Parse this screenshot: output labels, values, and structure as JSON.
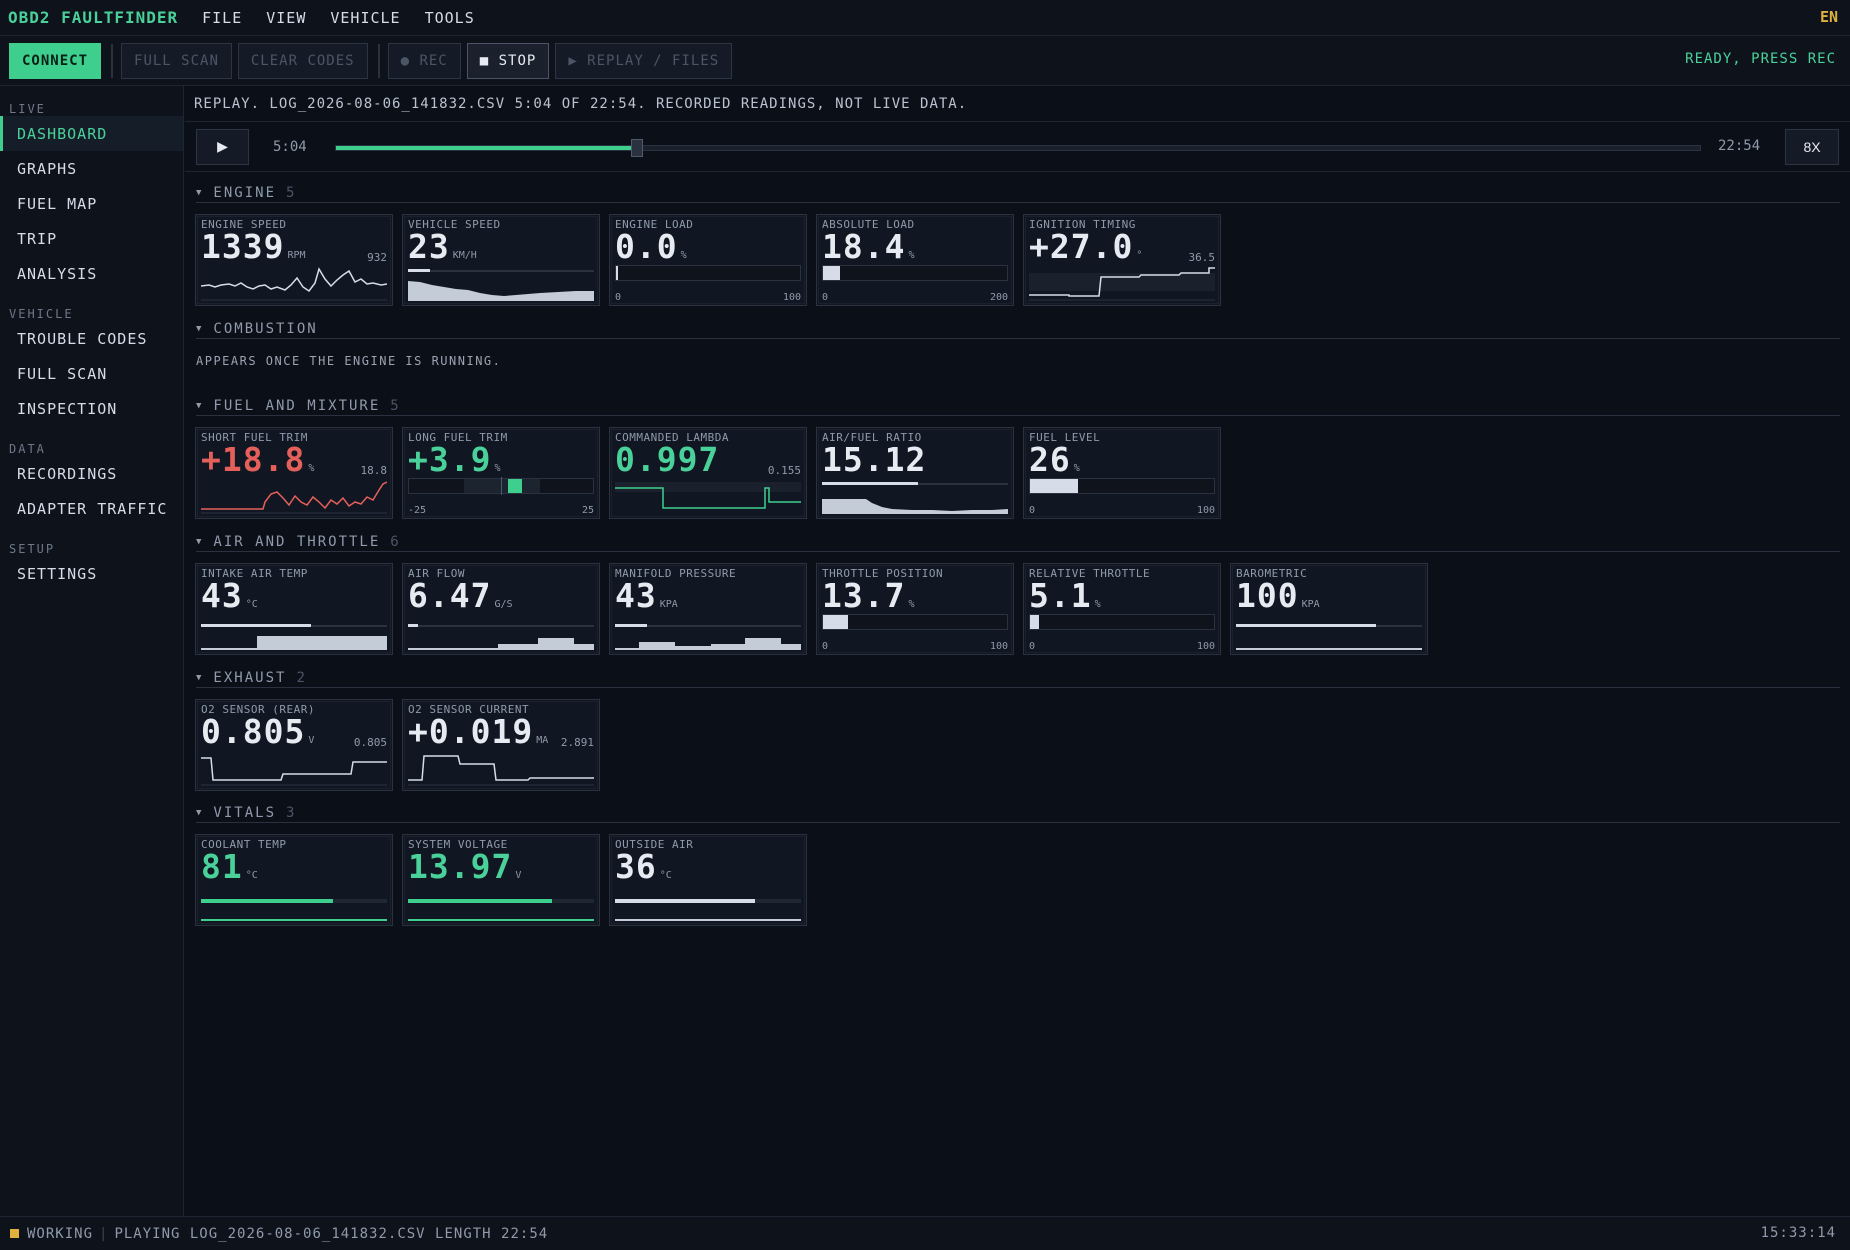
{
  "app": {
    "title": "OBD2 FAULTFINDER",
    "lang": "EN"
  },
  "menu": [
    "FILE",
    "VIEW",
    "VEHICLE",
    "TOOLS"
  ],
  "toolbar": {
    "connect": "CONNECT",
    "full_scan": "FULL SCAN",
    "clear_codes": "CLEAR CODES",
    "rec": "● REC",
    "stop": "■ STOP",
    "replay": "▶ REPLAY / FILES",
    "status": "READY, PRESS REC"
  },
  "sidebar": {
    "groups": [
      {
        "heading": "LIVE",
        "items": [
          "DASHBOARD",
          "GRAPHS",
          "FUEL MAP",
          "TRIP",
          "ANALYSIS"
        ]
      },
      {
        "heading": "VEHICLE",
        "items": [
          "TROUBLE CODES",
          "FULL SCAN",
          "INSPECTION"
        ]
      },
      {
        "heading": "DATA",
        "items": [
          "RECORDINGS",
          "ADAPTER TRAFFIC"
        ]
      },
      {
        "heading": "SETUP",
        "items": [
          "SETTINGS"
        ]
      }
    ],
    "active": "DASHBOARD"
  },
  "replay": {
    "banner": "REPLAY. LOG_2026-08-06_141832.CSV 5:04 OF 22:54. RECORDED READINGS, NOT LIVE DATA.",
    "play_icon": "▶",
    "position": "5:04",
    "length": "22:54",
    "progress_fraction": 0.221,
    "speed": "8X"
  },
  "sections": {
    "engine": {
      "title": "ENGINE",
      "count": "5"
    },
    "combustion": {
      "title": "COMBUSTION",
      "note": "APPEARS ONCE THE ENGINE IS RUNNING."
    },
    "fuel": {
      "title": "FUEL AND MIXTURE",
      "count": "5"
    },
    "air": {
      "title": "AIR AND THROTTLE",
      "count": "6"
    },
    "exhaust": {
      "title": "EXHAUST",
      "count": "2"
    },
    "vitals": {
      "title": "VITALS",
      "count": "3"
    }
  },
  "cards": {
    "engine_speed": {
      "label": "ENGINE SPEED",
      "value": "1339",
      "unit": "RPM",
      "peak": "932"
    },
    "vehicle_speed": {
      "label": "VEHICLE SPEED",
      "value": "23",
      "unit": "KM/H"
    },
    "engine_load": {
      "label": "ENGINE LOAD",
      "value": "0.0",
      "unit": "%",
      "min": "0",
      "max": "100",
      "level": 0.0
    },
    "absolute_load": {
      "label": "ABSOLUTE LOAD",
      "value": "18.4",
      "unit": "%",
      "min": "0",
      "max": "200",
      "level": 0.092
    },
    "ignition_timing": {
      "label": "IGNITION TIMING",
      "value": "+27.0",
      "unit": "°",
      "peak": "36.5"
    },
    "short_fuel_trim": {
      "label": "SHORT FUEL TRIM",
      "value": "+18.8",
      "unit": "%",
      "peak": "18.8"
    },
    "long_fuel_trim": {
      "label": "LONG FUEL TRIM",
      "value": "+3.9",
      "unit": "%",
      "min": "-25",
      "max": "25",
      "level": 3.9
    },
    "commanded_lambda": {
      "label": "COMMANDED LAMBDA",
      "value": "0.997",
      "unit": "",
      "peak": "0.155"
    },
    "air_fuel_ratio": {
      "label": "AIR/FUEL RATIO",
      "value": "15.12",
      "unit": ""
    },
    "fuel_level": {
      "label": "FUEL LEVEL",
      "value": "26",
      "unit": "%",
      "min": "0",
      "max": "100",
      "level": 0.26
    },
    "intake_air_temp": {
      "label": "INTAKE AIR TEMP",
      "value": "43",
      "unit": "°C"
    },
    "air_flow": {
      "label": "AIR FLOW",
      "value": "6.47",
      "unit": "G/S"
    },
    "manifold_pressure": {
      "label": "MANIFOLD PRESSURE",
      "value": "43",
      "unit": "KPA"
    },
    "throttle_position": {
      "label": "THROTTLE POSITION",
      "value": "13.7",
      "unit": "%",
      "min": "0",
      "max": "100",
      "level": 0.137
    },
    "relative_throttle": {
      "label": "RELATIVE THROTTLE",
      "value": "5.1",
      "unit": "%",
      "min": "0",
      "max": "100",
      "level": 0.051
    },
    "barometric": {
      "label": "BAROMETRIC",
      "value": "100",
      "unit": "KPA"
    },
    "o2_rear": {
      "label": "O2 SENSOR (REAR)",
      "value": "0.805",
      "unit": "V",
      "peak": "0.805"
    },
    "o2_current": {
      "label": "O2 SENSOR CURRENT",
      "value": "+0.019",
      "unit": "MA",
      "peak": "2.891"
    },
    "coolant_temp": {
      "label": "COOLANT TEMP",
      "value": "81",
      "unit": "°C"
    },
    "system_voltage": {
      "label": "SYSTEM VOLTAGE",
      "value": "13.97",
      "unit": "V"
    },
    "outside_air": {
      "label": "OUTSIDE AIR",
      "value": "36",
      "unit": "°C"
    }
  },
  "colors": {
    "accent": "#3ecf8e",
    "warn": "#e5605a",
    "amber": "#e0b03c",
    "bg": "#0b0f17"
  },
  "statusbar": {
    "state": "WORKING",
    "message": "PLAYING LOG_2026-08-06_141832.CSV LENGTH 22:54",
    "clock": "15:33:14"
  }
}
